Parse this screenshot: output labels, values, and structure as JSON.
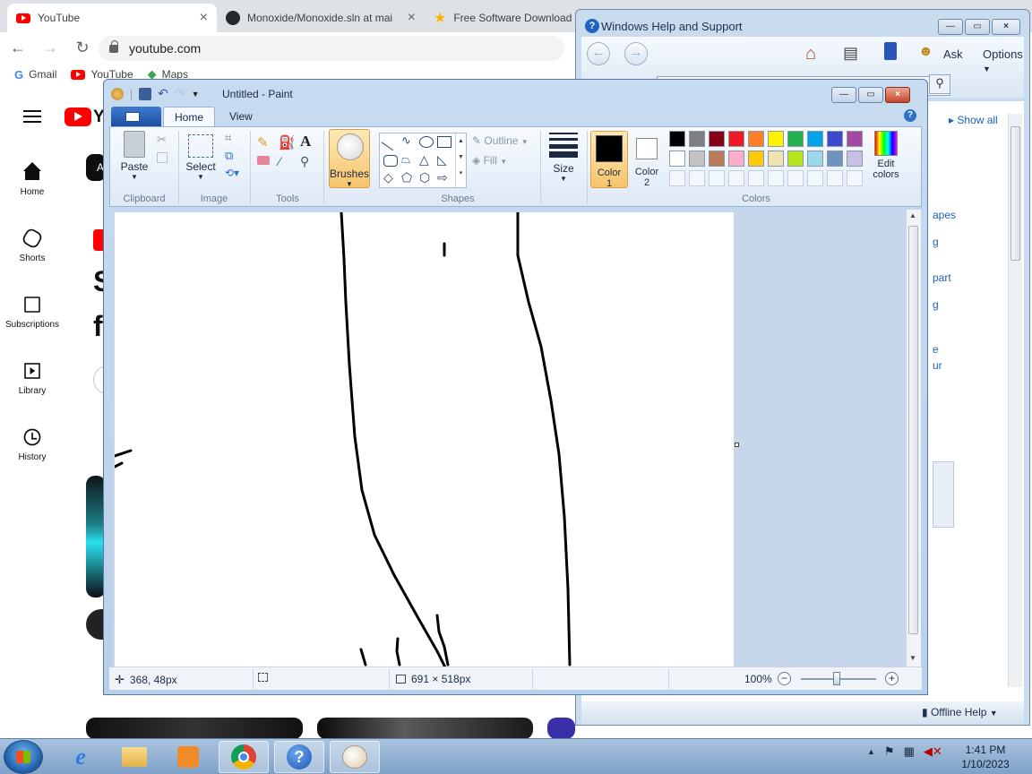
{
  "browser": {
    "tabs": [
      {
        "title": "YouTube",
        "active": true
      },
      {
        "title": "Monoxide/Monoxide.sln at mai",
        "active": false
      },
      {
        "title": "Free Software Download F",
        "active": false
      }
    ],
    "address": "youtube.com",
    "bookmarks": [
      "Gmail",
      "YouTube",
      "Maps"
    ]
  },
  "youtube": {
    "logo_text": "Yo",
    "nav": [
      {
        "label": "Home",
        "icon": "home-icon"
      },
      {
        "label": "Shorts",
        "icon": "shorts-icon"
      },
      {
        "label": "Subscriptions",
        "icon": "subscriptions-icon"
      },
      {
        "label": "Library",
        "icon": "library-icon"
      },
      {
        "label": "History",
        "icon": "history-icon"
      }
    ],
    "fragments": {
      "chip": "A",
      "heading1": "S",
      "heading2": "f"
    }
  },
  "help_window": {
    "title": "Windows Help and Support",
    "toolbar": {
      "ask": "Ask",
      "options": "Options"
    },
    "show_all": "Show all",
    "links": [
      "apes",
      "g",
      "part",
      "g",
      "e",
      "ur"
    ],
    "footer": "Offline Help"
  },
  "paint": {
    "title": "Untitled - Paint",
    "tabs": {
      "home": "Home",
      "view": "View"
    },
    "groups": {
      "clipboard": "Clipboard",
      "image": "Image",
      "tools": "Tools",
      "shapes": "Shapes",
      "colors": "Colors"
    },
    "buttons": {
      "paste": "Paste",
      "select": "Select",
      "brushes": "Brushes",
      "outline": "Outline",
      "fill": "Fill",
      "size": "Size",
      "color1_a": "Color",
      "color1_b": "1",
      "color2_a": "Color",
      "color2_b": "2",
      "edit_colors_a": "Edit",
      "edit_colors_b": "colors"
    },
    "color1": "#000000",
    "color2": "#ffffff",
    "palette_row1": [
      "#000000",
      "#7f7f7f",
      "#880015",
      "#ed1c24",
      "#ff7f27",
      "#fff200",
      "#22b14c",
      "#00a2e8",
      "#3f48cc",
      "#a349a4"
    ],
    "palette_row2": [
      "#ffffff",
      "#c3c3c3",
      "#b97a57",
      "#ffaec9",
      "#ffc90e",
      "#efe4b0",
      "#b5e61d",
      "#99d9ea",
      "#7092be",
      "#c8bfe7"
    ],
    "status": {
      "cursor_pos": "368, 48px",
      "canvas_size": "691 × 518px",
      "zoom": "100%"
    }
  },
  "taskbar": {
    "time": "1:41 PM",
    "date": "1/10/2023"
  }
}
